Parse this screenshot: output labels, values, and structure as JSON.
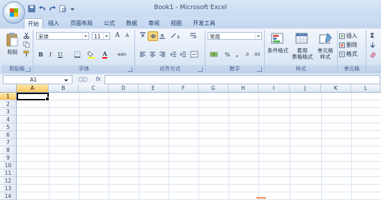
{
  "window": {
    "title": "Book1 - Microsoft Excel"
  },
  "tabs": [
    "开始",
    "插入",
    "页面布局",
    "公式",
    "数据",
    "审阅",
    "视图",
    "开发工具"
  ],
  "ribbon": {
    "clipboard": {
      "label": "剪贴板",
      "paste": "粘贴"
    },
    "font": {
      "label": "字体",
      "name": "宋体",
      "size": "11",
      "bold": "B",
      "italic": "I",
      "underline": "U",
      "font_color_letter": "A",
      "grow": "A",
      "shrink": "A",
      "phonetic": "wén"
    },
    "alignment": {
      "label": "对齐方式"
    },
    "number": {
      "label": "数字",
      "format": "常规",
      "percent": "%",
      "comma": ",",
      "increase_decimal": ".0",
      "decrease_decimal": ".00"
    },
    "styles": {
      "label": "样式",
      "conditional": "条件格式",
      "table": "套用\n表格格式",
      "cell": "单元格\n样式"
    },
    "cells": {
      "label": "单元格",
      "insert": "插入",
      "delete": "删除",
      "format": "格式"
    },
    "editing": {
      "sigma": "Σ"
    }
  },
  "formula_bar": {
    "name_box": "A1",
    "fx": "fx",
    "value": ""
  },
  "grid": {
    "columns": [
      "A",
      "B",
      "C",
      "D",
      "E",
      "F",
      "G",
      "H",
      "I",
      "J",
      "K",
      "L"
    ],
    "rows": [
      "1",
      "2",
      "3",
      "4",
      "5",
      "6",
      "7",
      "8",
      "9",
      "10",
      "11",
      "12",
      "13",
      "14"
    ],
    "selected_cell": "A1"
  }
}
